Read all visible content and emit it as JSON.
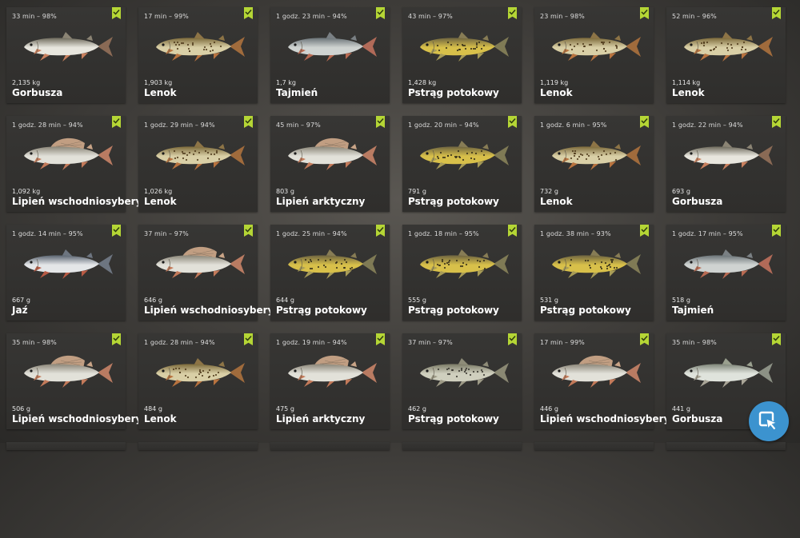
{
  "catches": [
    {
      "time": "33 min – 98%",
      "weight": "2,135 kg",
      "name": "Gorbusza",
      "species": "pink-salmon"
    },
    {
      "time": "17 min – 99%",
      "weight": "1,903 kg",
      "name": "Lenok",
      "species": "lenok"
    },
    {
      "time": "1 godz. 23 min – 94%",
      "weight": "1,7 kg",
      "name": "Tajmień",
      "species": "taimen"
    },
    {
      "time": "43 min – 97%",
      "weight": "1,428 kg",
      "name": "Pstrąg potokowy",
      "species": "brown-trout"
    },
    {
      "time": "23 min – 98%",
      "weight": "1,119 kg",
      "name": "Lenok",
      "species": "lenok"
    },
    {
      "time": "52 min – 96%",
      "weight": "1,114 kg",
      "name": "Lenok",
      "species": "lenok"
    },
    {
      "time": "1 godz. 28 min – 94%",
      "weight": "1,092 kg",
      "name": "Lipień wschodniosyberyjski",
      "species": "grayling"
    },
    {
      "time": "1 godz. 29 min – 94%",
      "weight": "1,026 kg",
      "name": "Lenok",
      "species": "lenok"
    },
    {
      "time": "45 min – 97%",
      "weight": "803 g",
      "name": "Lipień arktyczny",
      "species": "grayling"
    },
    {
      "time": "1 godz. 20 min – 94%",
      "weight": "791 g",
      "name": "Pstrąg potokowy",
      "species": "brown-trout"
    },
    {
      "time": "1 godz. 6 min – 95%",
      "weight": "732 g",
      "name": "Lenok",
      "species": "lenok"
    },
    {
      "time": "1 godz. 22 min – 94%",
      "weight": "693 g",
      "name": "Gorbusza",
      "species": "pink-salmon"
    },
    {
      "time": "1 godz. 14 min – 95%",
      "weight": "667 g",
      "name": "Jaź",
      "species": "ide"
    },
    {
      "time": "37 min – 97%",
      "weight": "646 g",
      "name": "Lipień wschodniosyberyjski",
      "species": "grayling"
    },
    {
      "time": "1 godz. 25 min – 94%",
      "weight": "644 g",
      "name": "Pstrąg potokowy",
      "species": "brown-trout"
    },
    {
      "time": "1 godz. 18 min – 95%",
      "weight": "555 g",
      "name": "Pstrąg potokowy",
      "species": "brown-trout"
    },
    {
      "time": "1 godz. 38 min – 93%",
      "weight": "531 g",
      "name": "Pstrąg potokowy",
      "species": "brown-trout"
    },
    {
      "time": "1 godz. 17 min – 95%",
      "weight": "518 g",
      "name": "Tajmień",
      "species": "taimen"
    },
    {
      "time": "35 min – 98%",
      "weight": "506 g",
      "name": "Lipień wschodniosyberyjski",
      "species": "grayling"
    },
    {
      "time": "1 godz. 28 min – 94%",
      "weight": "484 g",
      "name": "Lenok",
      "species": "lenok"
    },
    {
      "time": "1 godz. 19 min – 94%",
      "weight": "475 g",
      "name": "Lipień arktyczny",
      "species": "grayling"
    },
    {
      "time": "37 min – 97%",
      "weight": "462 g",
      "name": "Pstrąg potokowy",
      "species": "brown-trout-silver"
    },
    {
      "time": "17 min – 99%",
      "weight": "446 g",
      "name": "Lipień wschodniosyberyjski",
      "species": "grayling"
    },
    {
      "time": "35 min – 98%",
      "weight": "441 g",
      "name": "Gorbusza",
      "species": "pink-salmon-silver"
    }
  ],
  "partial_row_count": 6,
  "badge_color": "#b5d635",
  "cursor_button": {
    "icon": "cursor-select-icon",
    "color": "#3c93cf"
  }
}
